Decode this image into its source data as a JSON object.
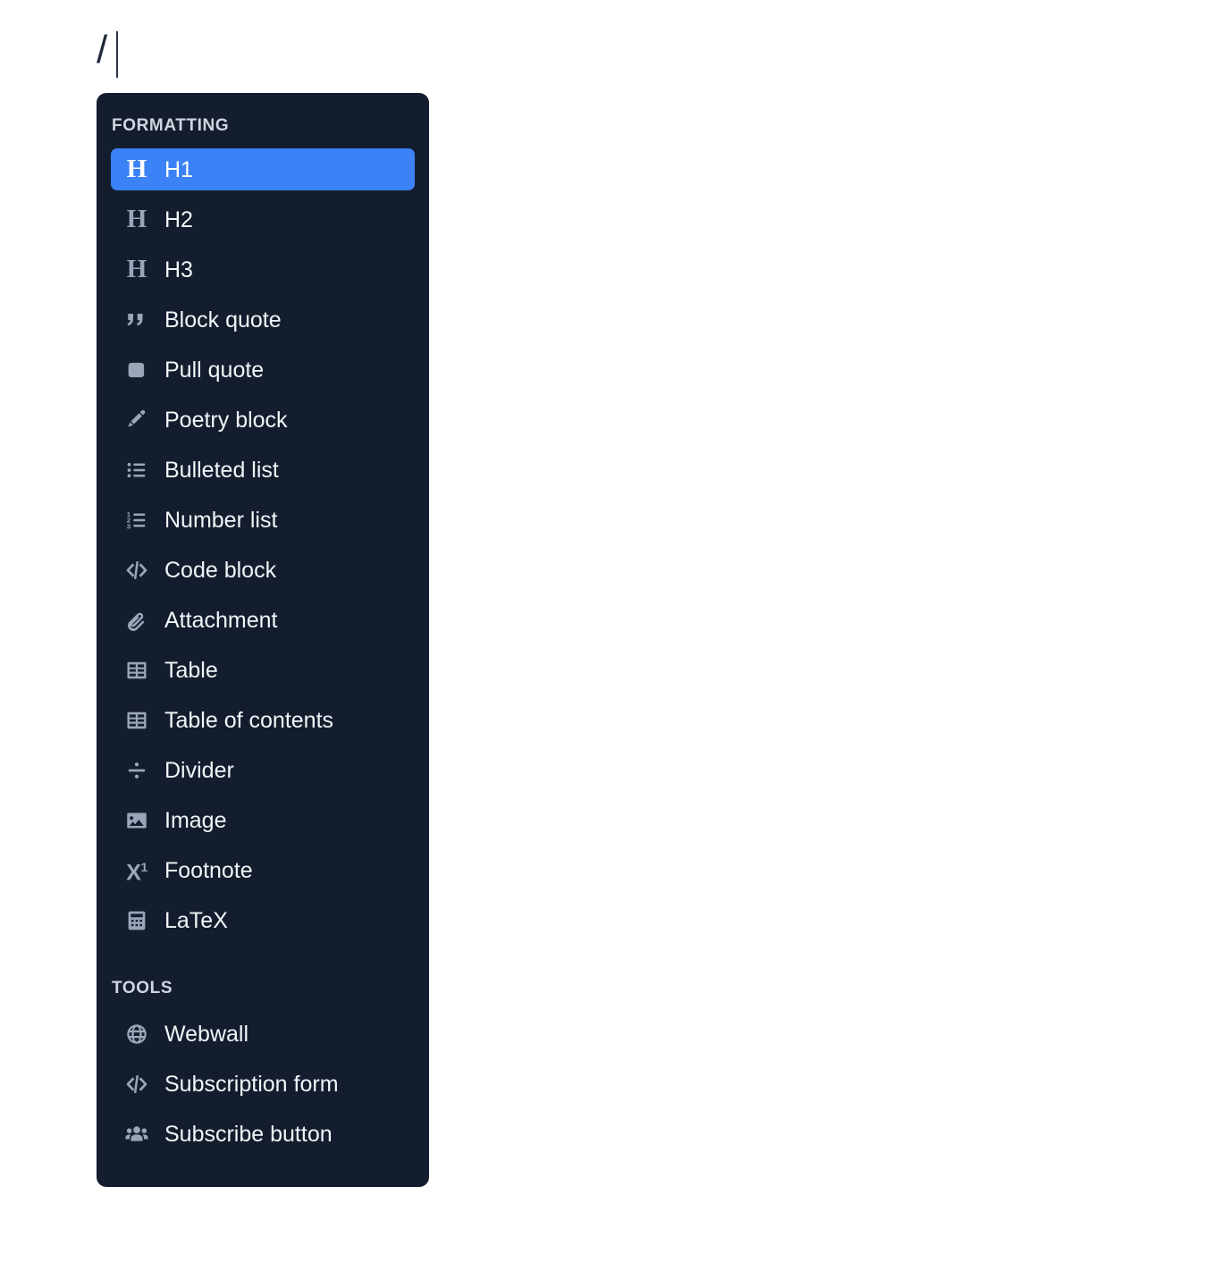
{
  "editor": {
    "text": "/",
    "caret": "text-cursor"
  },
  "colors": {
    "panel_bg": "#141d2e",
    "accent": "#3b82f6",
    "icon": "#9aa6b8",
    "label": "#f2f5f8",
    "section_title": "#cfd6e0",
    "page_bg": "#ffffff"
  },
  "menu": {
    "sections": [
      {
        "title": "FORMATTING",
        "items": [
          {
            "label": "H1",
            "icon": "heading-one-icon",
            "selected": true
          },
          {
            "label": "H2",
            "icon": "heading-two-icon",
            "selected": false
          },
          {
            "label": "H3",
            "icon": "heading-three-icon",
            "selected": false
          },
          {
            "label": "Block quote",
            "icon": "quote-icon",
            "selected": false
          },
          {
            "label": "Pull quote",
            "icon": "pull-quote-icon",
            "selected": false
          },
          {
            "label": "Poetry block",
            "icon": "pen-nib-icon",
            "selected": false
          },
          {
            "label": "Bulleted list",
            "icon": "bulleted-list-icon",
            "selected": false
          },
          {
            "label": "Number list",
            "icon": "numbered-list-icon",
            "selected": false
          },
          {
            "label": "Code block",
            "icon": "code-icon",
            "selected": false
          },
          {
            "label": "Attachment",
            "icon": "paperclip-icon",
            "selected": false
          },
          {
            "label": "Table",
            "icon": "table-icon",
            "selected": false
          },
          {
            "label": "Table of contents",
            "icon": "table-icon",
            "selected": false
          },
          {
            "label": "Divider",
            "icon": "divide-icon",
            "selected": false
          },
          {
            "label": "Image",
            "icon": "image-icon",
            "selected": false
          },
          {
            "label": "Footnote",
            "icon": "superscript-icon",
            "selected": false
          },
          {
            "label": "LaTeX",
            "icon": "calculator-icon",
            "selected": false
          }
        ]
      },
      {
        "title": "TOOLS",
        "items": [
          {
            "label": "Webwall",
            "icon": "globe-icon",
            "selected": false
          },
          {
            "label": "Subscription form",
            "icon": "code-icon",
            "selected": false
          },
          {
            "label": "Subscribe button",
            "icon": "people-group-icon",
            "selected": false
          }
        ]
      }
    ]
  }
}
